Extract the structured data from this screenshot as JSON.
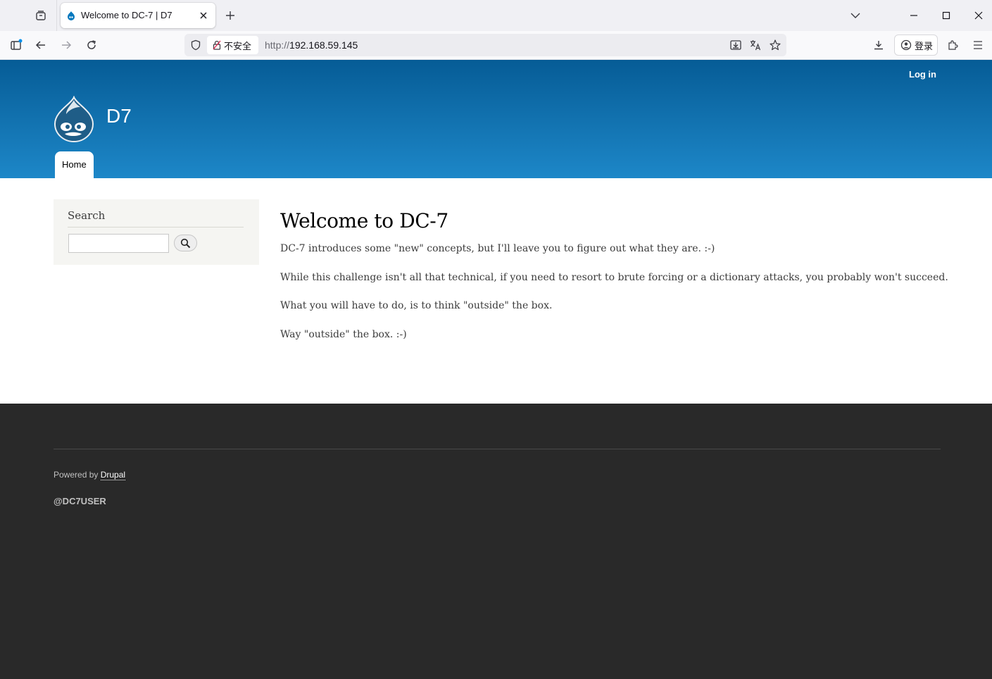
{
  "browser": {
    "tab_title": "Welcome to DC-7 | D7",
    "insecure_label": "不安全",
    "url_protocol": "http://",
    "url_host": "192.168.59.145",
    "signin_label": "登录"
  },
  "site": {
    "login_link": "Log in",
    "site_name": "D7",
    "nav_home": "Home",
    "brand_color": "#0779bf"
  },
  "sidebar": {
    "search_title": "Search",
    "search_value": ""
  },
  "main": {
    "title": "Welcome to DC-7",
    "paragraphs": [
      "DC-7 introduces some \"new\" concepts, but I'll leave you to figure out what they are.  :-)",
      "While this challenge isn't all that technical, if you need to resort to brute forcing or a dictionary attacks, you probably won't succeed.",
      "What you will have to do, is to think \"outside\" the box.",
      "Way \"outside\" the box.  :-)"
    ]
  },
  "footer": {
    "powered_prefix": "Powered by ",
    "powered_link": "Drupal",
    "handle": "@DC7USER"
  }
}
